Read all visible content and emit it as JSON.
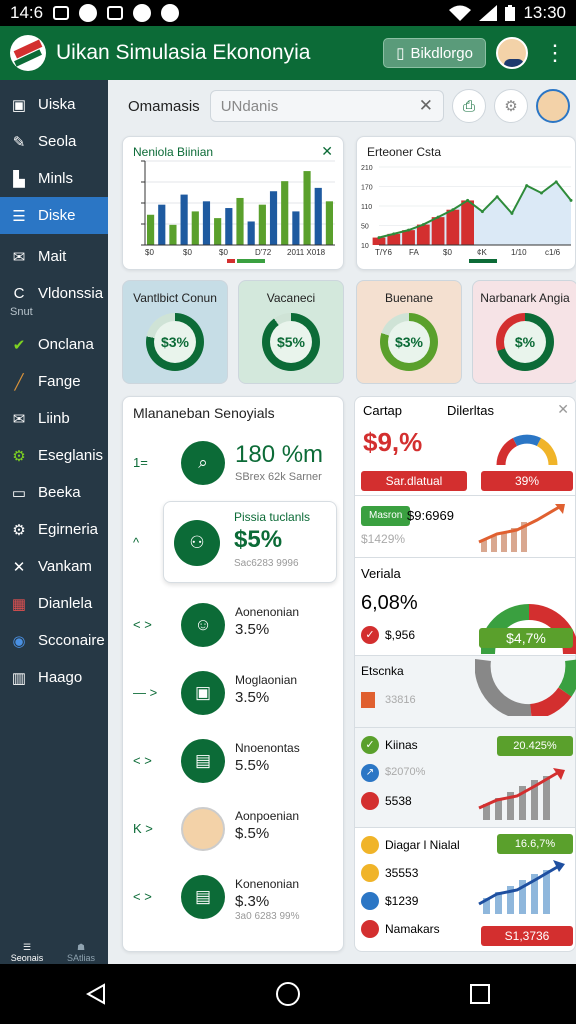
{
  "status": {
    "time_left": "14:6",
    "time_right": "13:30"
  },
  "app": {
    "title": "Uikan Simulasia Ekononyia",
    "button_label": "Bikdlorgo"
  },
  "sidebar": {
    "items": [
      {
        "label": "Uiska",
        "icon": "clipboard-icon"
      },
      {
        "label": "Seola",
        "icon": "pencil-icon"
      },
      {
        "label": "Minls",
        "icon": "building-icon"
      },
      {
        "label": "Diske",
        "icon": "menu-icon",
        "active": true
      },
      {
        "label": "Mait",
        "icon": "mail-icon"
      },
      {
        "label": "Vldonssia",
        "icon": "c-icon",
        "sub": "Snut"
      },
      {
        "label": "Onclana",
        "icon": "check-icon"
      },
      {
        "label": "Fange",
        "icon": "pen-icon"
      },
      {
        "label": "Liinb",
        "icon": "mail-icon"
      },
      {
        "label": "Eseglanis",
        "icon": "gear-icon"
      },
      {
        "label": "Beeka",
        "icon": "window-icon"
      },
      {
        "label": "Egirneria",
        "icon": "settings-icon"
      },
      {
        "label": "Vankam",
        "icon": "tools-icon"
      },
      {
        "label": "Dianlela",
        "icon": "grid-icon"
      },
      {
        "label": "Scconaire",
        "icon": "toggle-icon"
      },
      {
        "label": "Haago",
        "icon": "chart-icon"
      }
    ],
    "footer": [
      "Seonais",
      "SAtlias"
    ]
  },
  "search": {
    "label": "Omamasis",
    "placeholder": "UNdanis"
  },
  "card1": {
    "title": "Neniola Biinian",
    "xlabels": [
      "$0",
      "$0",
      "$0",
      "D'72",
      "2011 X018"
    ]
  },
  "card2": {
    "title": "Erteoner Csta",
    "ylabels": [
      "210",
      "170",
      "110",
      "50",
      "10"
    ],
    "xlabels": [
      "T/Y6",
      "FA",
      "$0",
      "¢K",
      "1/10",
      "c1/6"
    ]
  },
  "kpis": [
    {
      "title": "Vantlbict Conun",
      "value": "$3%",
      "color": "#0c6b37",
      "pct": 0.78,
      "bg": "#c6dde6"
    },
    {
      "title": "Vacaneci",
      "value": "$5%",
      "color": "#0c6b37",
      "pct": 0.9,
      "bg": "#d3e8dc"
    },
    {
      "title": "Buenane",
      "value": "$3%",
      "color": "#5aa02c",
      "pct": 0.8,
      "bg": "#f4e0d0"
    },
    {
      "title": "Narbanark Angia",
      "value": "$%",
      "color": "#0c6b37",
      "pct": 0.7,
      "bg": "#f6e3e6"
    }
  ],
  "list": {
    "title": "Mlananeban Senoyials",
    "featured": {
      "value": "180 %m",
      "sub": "SBrex 62k Sarner"
    },
    "highlight": {
      "name": "Pissia tuclanls",
      "value": "$5%",
      "sub": "Sac6283 9996"
    },
    "rows": [
      {
        "name": "Aonenonian",
        "value": "3.5%"
      },
      {
        "name": "Moglaonian",
        "value": "3.5%"
      },
      {
        "name": "Nnoenontas",
        "value": "5.5%"
      },
      {
        "name": "Aonpoenian",
        "value": "$.5%"
      },
      {
        "name": "Konenonian",
        "value": "$.3%",
        "sub": "3a0 6283 99%"
      }
    ]
  },
  "right": {
    "header": {
      "left": "Cartap",
      "right": "Dilerltas"
    },
    "top": {
      "value": "$9,%",
      "pill": "Sar.dlatual",
      "pill2": "39%"
    },
    "row2": {
      "tag": "Masron",
      "value": "$9:6969",
      "sub": "$1429%"
    },
    "section3": {
      "title": "Veriala",
      "value": "6,08%",
      "sub": "$,956",
      "pill": "$4,7%"
    },
    "section4": {
      "title": "Etscnka",
      "sub": "33816"
    },
    "section5": {
      "items": [
        "Kiinas",
        "$2070%",
        "5538"
      ],
      "pill": "20.425%"
    },
    "section6": {
      "items": [
        "Diagar l Nialal",
        "35553",
        "$1239",
        "Namakars"
      ],
      "pill": "16.6,7%",
      "pill2": "S1,3736"
    }
  },
  "chart_data": [
    {
      "type": "bar",
      "title": "Neniola Biinian",
      "series": [
        {
          "values": [
            9,
            12,
            6,
            15,
            10,
            13,
            8,
            11,
            14,
            7,
            12,
            16,
            19,
            10,
            22,
            17,
            13
          ]
        }
      ],
      "ylim": [
        0,
        25
      ]
    },
    {
      "type": "area",
      "title": "Erteoner Csta",
      "series": [
        {
          "values": [
            20,
            30,
            40,
            55,
            75,
            95,
            120,
            90,
            130,
            85,
            160,
            140,
            170,
            120
          ]
        }
      ],
      "ylim": [
        0,
        210
      ]
    }
  ],
  "colors": {
    "brand": "#0c6b37",
    "sidebar": "#263845",
    "accent": "#2b76c5",
    "red": "#d32f2f",
    "lime": "#5aa02c"
  }
}
